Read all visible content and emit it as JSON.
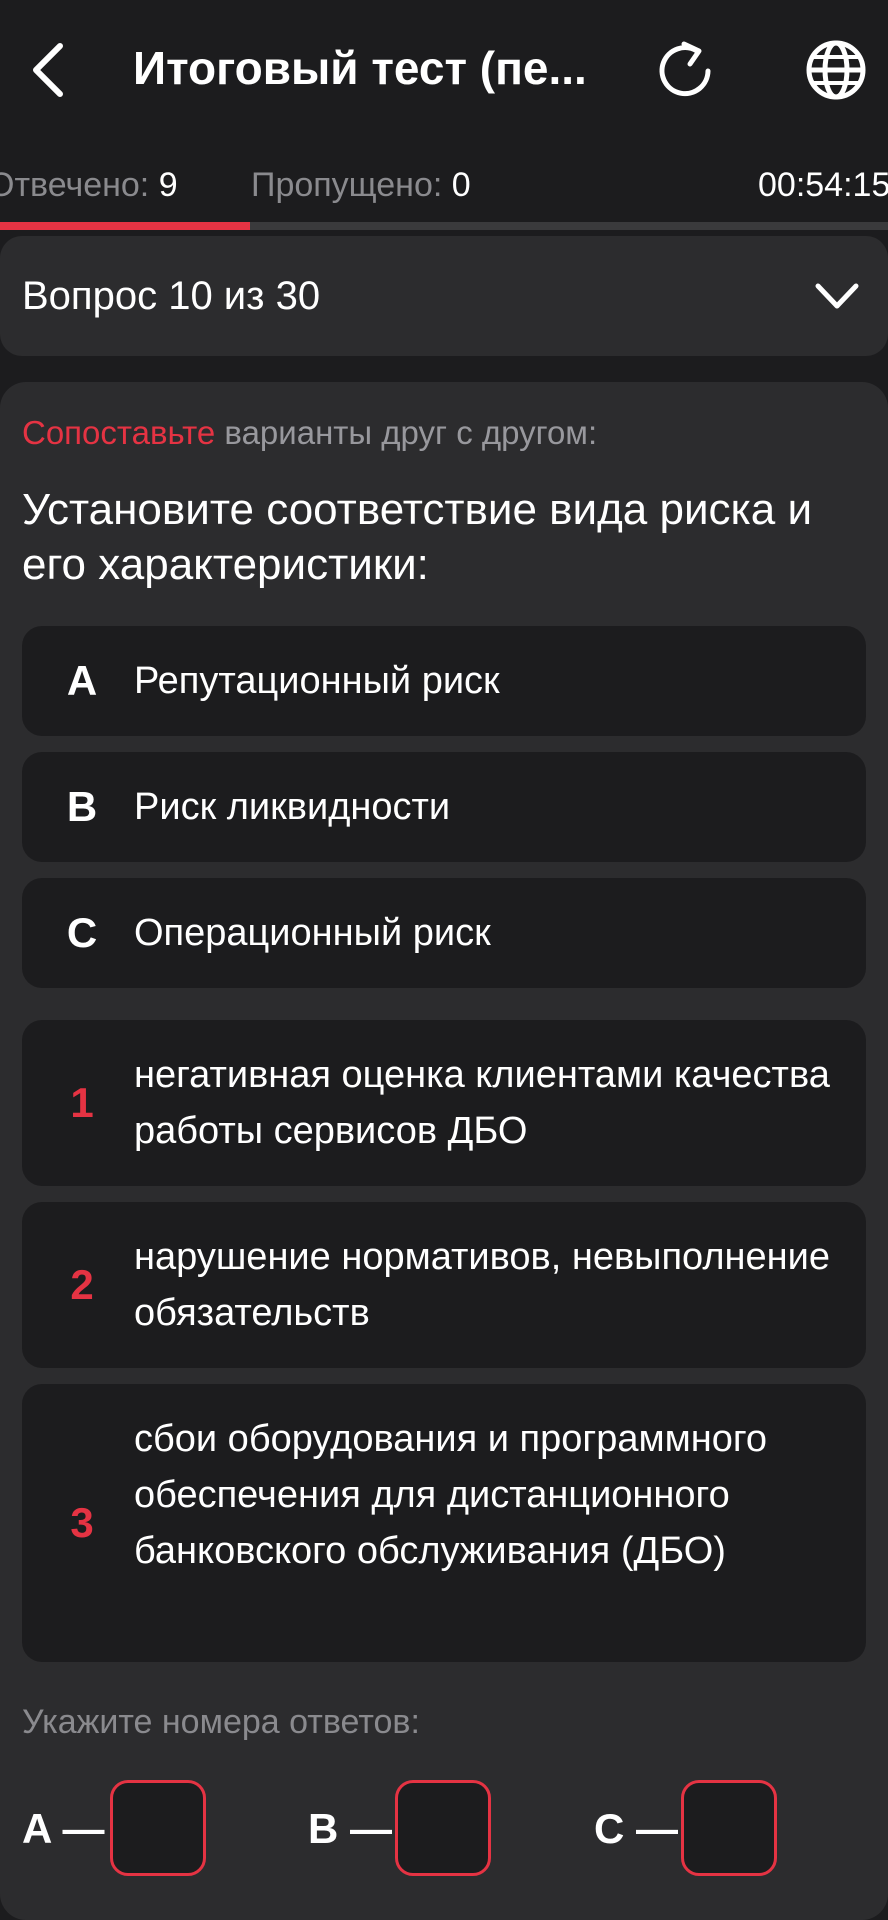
{
  "header": {
    "title": "Итоговый тест (пе...",
    "icons": {
      "back": "back-arrow-icon",
      "reload": "reload-icon",
      "language": "globe-icon"
    }
  },
  "stats": {
    "answered_label": "Отвечено:",
    "answered_value": "9",
    "skipped_label": "Пропущено:",
    "skipped_value": "0",
    "timer": "00:54:15"
  },
  "progress": {
    "answered": 9,
    "total": 30,
    "fraction": 0.3
  },
  "question_selector": {
    "label": "Вопрос 10 из 30",
    "icon": "chevron-down-icon"
  },
  "question": {
    "instruction_accent": "Сопоставьте",
    "instruction_rest": " варианты друг с другом:",
    "text": "Установите соответствие вида риска и его характеристики:"
  },
  "items": [
    {
      "key": "A",
      "text": "Репутационный риск"
    },
    {
      "key": "B",
      "text": "Риск ликвидности"
    },
    {
      "key": "C",
      "text": "Операционный риск"
    }
  ],
  "options": [
    {
      "key": "1",
      "text": "негативная оценка клиентами качества работы сервисов ДБО"
    },
    {
      "key": "2",
      "text": "нарушение нормативов, невыполнение обязательств"
    },
    {
      "key": "3",
      "text": "сбои оборудования и программного обеспечения для дистанционного банковского обслуживания (ДБО)"
    }
  ],
  "answer": {
    "prompt": "Укажите номера ответов:",
    "labels": [
      "A —",
      "B —",
      "C —"
    ],
    "values": [
      "",
      "",
      ""
    ]
  },
  "colors": {
    "accent": "#e53343",
    "background": "#1c1c1e",
    "card": "#2c2c2e",
    "muted": "#8a8a8e"
  }
}
